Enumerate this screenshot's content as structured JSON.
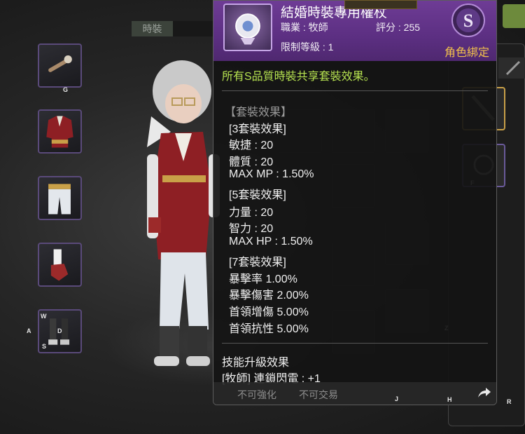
{
  "tabs": {
    "costume_label": "時裝"
  },
  "hotkeys": {
    "g": "G",
    "w": "W",
    "a": "A",
    "d": "D",
    "s": "S",
    "f": "F",
    "z": "Z",
    "j": "J",
    "h": "H",
    "r": "R"
  },
  "tooltip": {
    "item_name": "結婚時裝專用權杖",
    "job_label": "職業 : 牧師",
    "score_label": "評分 : 255",
    "level_label": "限制等級 : 1",
    "bound_label": "角色綁定",
    "grade": "S",
    "set_share_text": "所有S品質時裝共享套裝效果。",
    "set_section_title": "【套裝效果】",
    "set_tiers": [
      {
        "title": "[3套裝效果]",
        "stats": [
          "敏捷 : 20",
          "體質 : 20",
          "MAX MP :   1.50%"
        ]
      },
      {
        "title": "[5套裝效果]",
        "stats": [
          "力量 : 20",
          "智力 : 20",
          "MAX HP :   1.50%"
        ]
      },
      {
        "title": "[7套裝效果]",
        "stats": [
          "暴擊率 1.00%",
          "暴擊傷害 2.00%",
          "首領增傷 5.00%",
          "首領抗性 5.00%"
        ]
      }
    ],
    "skill_title": "技能升級效果",
    "skill_line": "[牧師] 連鎖閃電 :  +1",
    "footer": {
      "no_enhance": "不可強化",
      "no_trade": "不可交易"
    }
  },
  "colors": {
    "header_purple": "#6e3c95",
    "bound_gold": "#f3c24b",
    "set_share_green": "#b6e250"
  }
}
